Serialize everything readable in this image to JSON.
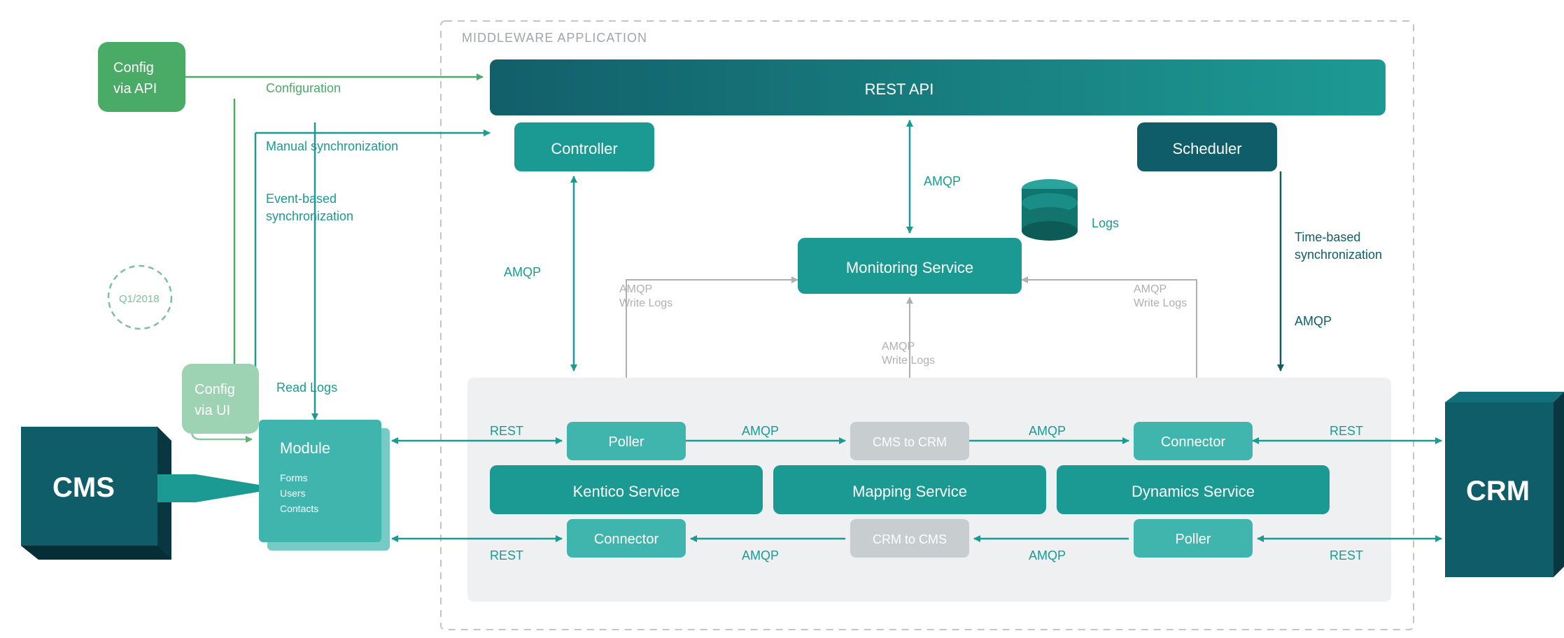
{
  "header": {
    "title": "MIDDLEWARE APPLICATION"
  },
  "left": {
    "config_api": "Config",
    "config_api2": "via API",
    "badge": "Q1/2018",
    "config_ui": "Config",
    "config_ui2": "via UI",
    "cms": "CMS",
    "module": "Module",
    "module_lines": {
      "l1": "Forms",
      "l2": "Users",
      "l3": "Contacts"
    }
  },
  "mid": {
    "rest_api": "REST API",
    "controller": "Controller",
    "scheduler": "Scheduler",
    "monitoring": "Monitoring Service",
    "logs": "Logs",
    "kentico": "Kentico Service",
    "mapping": "Mapping Service",
    "dynamics": "Dynamics Service",
    "poller1": "Poller",
    "poller2": "Poller",
    "connector1": "Connector",
    "connector2": "Connector",
    "cms_to_crm": "CMS to CRM",
    "crm_to_cms": "CRM to CMS"
  },
  "right": {
    "crm": "CRM"
  },
  "edges": {
    "configuration": "Configuration",
    "manual_sync": "Manual synchronization",
    "event_sync1": "Event-based",
    "event_sync2": "synchronization",
    "read_logs": "Read Logs",
    "amqp": "AMQP",
    "rest": "REST",
    "time_sync1": "Time-based",
    "time_sync2": "synchronization",
    "write_logs1": "AMQP",
    "write_logs2": "Write Logs"
  }
}
